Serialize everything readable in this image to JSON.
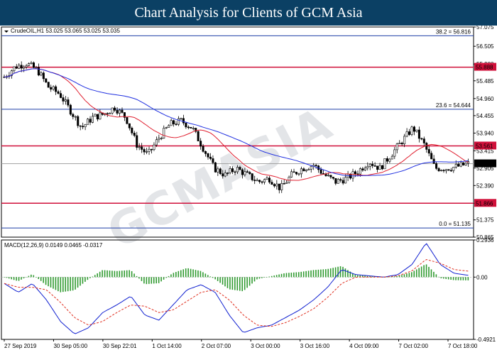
{
  "header": {
    "title": "Chart Analysis for Clients of GCM Asia"
  },
  "watermark": "GCMASIA",
  "chart_data": [
    {
      "type": "candlestick",
      "symbol_label": "CrudeOIL,H1  53.025 53.065 53.025 53.035",
      "price_scale": [
        "57.075",
        "56.505",
        "55.980",
        "55.485",
        "54.960",
        "54.455",
        "53.940",
        "53.415",
        "52.905",
        "52.390",
        "51.865",
        "51.375",
        "50.865"
      ],
      "ylim": [
        50.865,
        57.075
      ],
      "x_ticks": [
        "27 Sep 2019",
        "30 Sep 05:00",
        "30 Sep 22:01",
        "1 Oct 14:00",
        "2 Oct 07:00",
        "3 Oct 00:00",
        "3 Oct 16:00",
        "4 Oct 09:00",
        "7 Oct 02:00",
        "7 Oct 18:00"
      ],
      "fibonacci": [
        {
          "label": "38.2 = 56.816",
          "value": 56.816,
          "color": "#1f3fa6"
        },
        {
          "label": "23.6 = 54.644",
          "value": 54.644,
          "color": "#1f3fa6"
        },
        {
          "label": "0.0 = 51.135",
          "value": 51.135,
          "color": "#1f3fa6"
        }
      ],
      "levels": [
        {
          "label": "55.888",
          "value": 55.888,
          "color": "#d0103a"
        },
        {
          "label": "53.561",
          "value": 53.561,
          "color": "#d0103a"
        },
        {
          "label": "51.866",
          "value": 51.866,
          "color": "#d0103a"
        }
      ],
      "current_price": {
        "label": "53.035",
        "value": 53.035
      },
      "close_path": [
        55.6,
        55.9,
        56.0,
        55.8,
        55.3,
        55.1,
        54.6,
        54.1,
        54.4,
        54.5,
        54.7,
        54.4,
        53.6,
        53.3,
        53.8,
        54.2,
        54.3,
        54.1,
        53.5,
        52.9,
        52.7,
        52.9,
        52.7,
        52.5,
        52.6,
        52.3,
        52.7,
        52.9,
        53.0,
        52.7,
        52.5,
        52.6,
        52.8,
        53.1,
        52.9,
        53.3,
        53.7,
        54.1,
        53.6,
        52.9,
        52.9,
        52.95,
        53.035
      ],
      "ma_fast_color": "#e02030",
      "ma_slow_color": "#2030e0"
    },
    {
      "type": "macd",
      "label": "MACD(12,26,9) 0.0149 0.0465 -0.0317",
      "y_ticks": [
        "0.2936",
        "0.00",
        "-0.4921"
      ],
      "ylim": [
        -0.4921,
        0.2936
      ],
      "macd_path": [
        -0.05,
        -0.12,
        -0.05,
        -0.18,
        -0.35,
        -0.45,
        -0.4,
        -0.28,
        -0.22,
        -0.15,
        -0.3,
        -0.34,
        -0.22,
        -0.1,
        -0.06,
        -0.12,
        -0.3,
        -0.44,
        -0.4,
        -0.38,
        -0.32,
        -0.26,
        -0.18,
        -0.08,
        0.06,
        0.02,
        0.01,
        0.0,
        0.02,
        0.1,
        0.27,
        0.1,
        0.03,
        0.015
      ],
      "signal_path": [
        -0.05,
        -0.08,
        -0.08,
        -0.1,
        -0.2,
        -0.32,
        -0.38,
        -0.35,
        -0.28,
        -0.22,
        -0.23,
        -0.28,
        -0.26,
        -0.19,
        -0.12,
        -0.1,
        -0.18,
        -0.3,
        -0.38,
        -0.39,
        -0.36,
        -0.31,
        -0.25,
        -0.16,
        -0.05,
        0.0,
        0.0,
        0.0,
        0.01,
        0.05,
        0.14,
        0.11,
        0.06,
        0.047
      ],
      "macd_color": "#1020d0",
      "signal_color": "#e03020",
      "histogram_color": "#2f9a2f"
    }
  ]
}
